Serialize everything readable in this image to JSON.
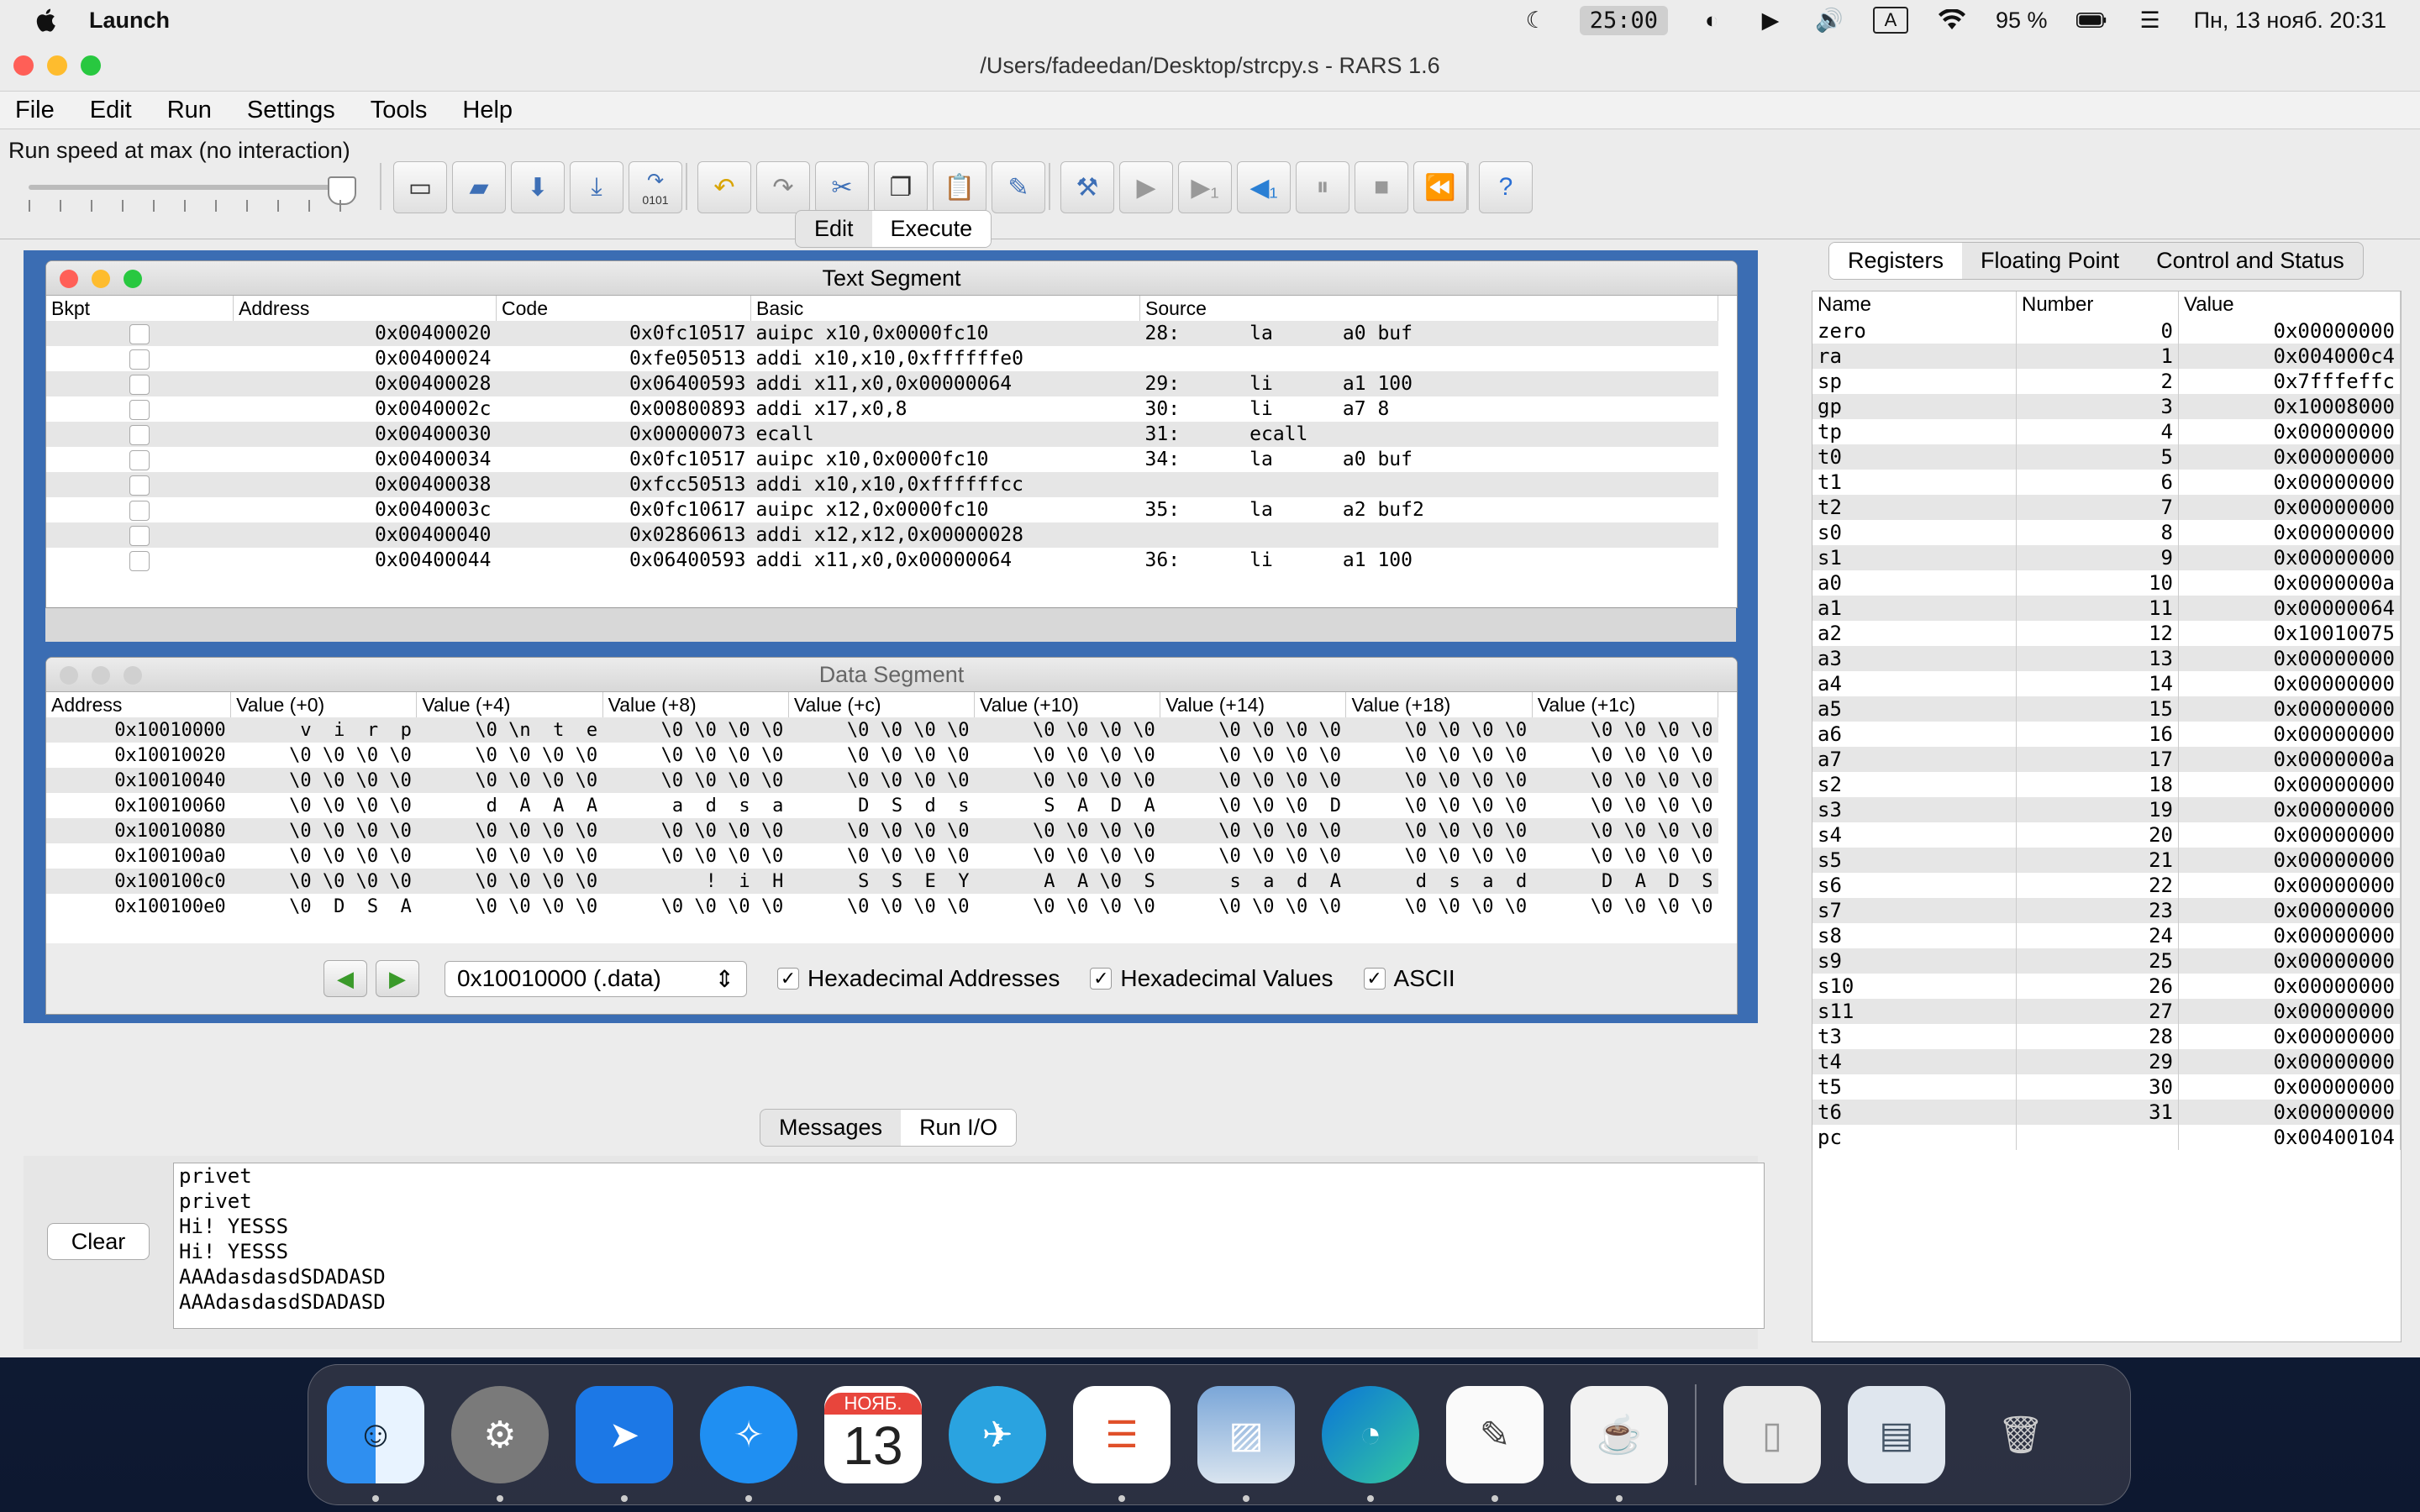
{
  "menubar": {
    "app_name": "Launch",
    "timer": "25:00",
    "keyboard_layout": "A",
    "battery": "95 %",
    "datetime": "Пн, 13 нояб.  20:31"
  },
  "window": {
    "title": "/Users/fadeedan/Desktop/strcpy.s  - RARS 1.6",
    "menu": [
      "File",
      "Edit",
      "Run",
      "Settings",
      "Tools",
      "Help"
    ]
  },
  "toolbar": {
    "run_speed": "Run speed at max (no interaction)",
    "open_label": "0101"
  },
  "tabs": {
    "edit": "Edit",
    "execute": "Execute"
  },
  "text_segment": {
    "title": "Text Segment",
    "headers": [
      "Bkpt",
      "Address",
      "Code",
      "Basic",
      "Source"
    ],
    "rows": [
      [
        "",
        "0x00400020",
        "0x0fc10517",
        "auipc x10,0x0000fc10",
        "28:      la      a0 buf"
      ],
      [
        "",
        "0x00400024",
        "0xfe050513",
        "addi x10,x10,0xffffffe0",
        ""
      ],
      [
        "",
        "0x00400028",
        "0x06400593",
        "addi x11,x0,0x00000064",
        "29:      li      a1 100"
      ],
      [
        "",
        "0x0040002c",
        "0x00800893",
        "addi x17,x0,8",
        "30:      li      a7 8"
      ],
      [
        "",
        "0x00400030",
        "0x00000073",
        "ecall",
        "31:      ecall"
      ],
      [
        "",
        "0x00400034",
        "0x0fc10517",
        "auipc x10,0x0000fc10",
        "34:      la      a0 buf"
      ],
      [
        "",
        "0x00400038",
        "0xfcc50513",
        "addi x10,x10,0xffffffcc",
        ""
      ],
      [
        "",
        "0x0040003c",
        "0x0fc10617",
        "auipc x12,0x0000fc10",
        "35:      la      a2 buf2"
      ],
      [
        "",
        "0x00400040",
        "0x02860613",
        "addi x12,x12,0x00000028",
        ""
      ],
      [
        "",
        "0x00400044",
        "0x06400593",
        "addi x11,x0,0x00000064",
        "36:      li      a1 100"
      ]
    ]
  },
  "data_segment": {
    "title": "Data Segment",
    "headers": [
      "Address",
      "Value (+0)",
      "Value (+4)",
      "Value (+8)",
      "Value (+c)",
      "Value (+10)",
      "Value (+14)",
      "Value (+18)",
      "Value (+1c)"
    ],
    "rows": [
      [
        "0x10010000",
        "v  i  r  p",
        "\\0 \\n  t  e",
        "\\0 \\0 \\0 \\0",
        "\\0 \\0 \\0 \\0",
        "\\0 \\0 \\0 \\0",
        "\\0 \\0 \\0 \\0",
        "\\0 \\0 \\0 \\0",
        "\\0 \\0 \\0 \\0"
      ],
      [
        "0x10010020",
        "\\0 \\0 \\0 \\0",
        "\\0 \\0 \\0 \\0",
        "\\0 \\0 \\0 \\0",
        "\\0 \\0 \\0 \\0",
        "\\0 \\0 \\0 \\0",
        "\\0 \\0 \\0 \\0",
        "\\0 \\0 \\0 \\0",
        "\\0 \\0 \\0 \\0"
      ],
      [
        "0x10010040",
        "\\0 \\0 \\0 \\0",
        "\\0 \\0 \\0 \\0",
        "\\0 \\0 \\0 \\0",
        "\\0 \\0 \\0 \\0",
        "\\0 \\0 \\0 \\0",
        "\\0 \\0 \\0 \\0",
        "\\0 \\0 \\0 \\0",
        "\\0 \\0 \\0 \\0"
      ],
      [
        "0x10010060",
        "\\0 \\0 \\0 \\0",
        "d  A  A  A",
        "a  d  s  a",
        "D  S  d  s",
        "S  A  D  A",
        "\\0 \\0 \\0  D",
        "\\0 \\0 \\0 \\0",
        "\\0 \\0 \\0 \\0"
      ],
      [
        "0x10010080",
        "\\0 \\0 \\0 \\0",
        "\\0 \\0 \\0 \\0",
        "\\0 \\0 \\0 \\0",
        "\\0 \\0 \\0 \\0",
        "\\0 \\0 \\0 \\0",
        "\\0 \\0 \\0 \\0",
        "\\0 \\0 \\0 \\0",
        "\\0 \\0 \\0 \\0"
      ],
      [
        "0x100100a0",
        "\\0 \\0 \\0 \\0",
        "\\0 \\0 \\0 \\0",
        "\\0 \\0 \\0 \\0",
        "\\0 \\0 \\0 \\0",
        "\\0 \\0 \\0 \\0",
        "\\0 \\0 \\0 \\0",
        "\\0 \\0 \\0 \\0",
        "\\0 \\0 \\0 \\0"
      ],
      [
        "0x100100c0",
        "\\0 \\0 \\0 \\0",
        "\\0 \\0 \\0 \\0",
        "!  i  H",
        "S  S  E  Y",
        "A  A \\0  S",
        "s  a  d  A",
        "d  s  a  d",
        "D  A  D  S"
      ],
      [
        "0x100100e0",
        "\\0  D  S  A",
        "\\0 \\0 \\0 \\0",
        "\\0 \\0 \\0 \\0",
        "\\0 \\0 \\0 \\0",
        "\\0 \\0 \\0 \\0",
        "\\0 \\0 \\0 \\0",
        "\\0 \\0 \\0 \\0",
        "\\0 \\0 \\0 \\0"
      ]
    ],
    "address_select": "0x10010000 (.data)",
    "options": [
      "Hexadecimal Addresses",
      "Hexadecimal Values",
      "ASCII"
    ]
  },
  "io": {
    "tabs": [
      "Messages",
      "Run I/O"
    ],
    "clear_label": "Clear",
    "lines": [
      "privet",
      "privet",
      "Hi! YESSS",
      "Hi! YESSS",
      "AAAdasdasdSDADASD",
      "AAAdasdasdSDADASD"
    ]
  },
  "registers": {
    "tabs": [
      "Registers",
      "Floating Point",
      "Control and Status"
    ],
    "headers": [
      "Name",
      "Number",
      "Value"
    ],
    "rows": [
      [
        "zero",
        "0",
        "0x00000000"
      ],
      [
        "ra",
        "1",
        "0x004000c4"
      ],
      [
        "sp",
        "2",
        "0x7fffeffc"
      ],
      [
        "gp",
        "3",
        "0x10008000"
      ],
      [
        "tp",
        "4",
        "0x00000000"
      ],
      [
        "t0",
        "5",
        "0x00000000"
      ],
      [
        "t1",
        "6",
        "0x00000000"
      ],
      [
        "t2",
        "7",
        "0x00000000"
      ],
      [
        "s0",
        "8",
        "0x00000000"
      ],
      [
        "s1",
        "9",
        "0x00000000"
      ],
      [
        "a0",
        "10",
        "0x0000000a"
      ],
      [
        "a1",
        "11",
        "0x00000064"
      ],
      [
        "a2",
        "12",
        "0x10010075"
      ],
      [
        "a3",
        "13",
        "0x00000000"
      ],
      [
        "a4",
        "14",
        "0x00000000"
      ],
      [
        "a5",
        "15",
        "0x00000000"
      ],
      [
        "a6",
        "16",
        "0x00000000"
      ],
      [
        "a7",
        "17",
        "0x0000000a"
      ],
      [
        "s2",
        "18",
        "0x00000000"
      ],
      [
        "s3",
        "19",
        "0x00000000"
      ],
      [
        "s4",
        "20",
        "0x00000000"
      ],
      [
        "s5",
        "21",
        "0x00000000"
      ],
      [
        "s6",
        "22",
        "0x00000000"
      ],
      [
        "s7",
        "23",
        "0x00000000"
      ],
      [
        "s8",
        "24",
        "0x00000000"
      ],
      [
        "s9",
        "25",
        "0x00000000"
      ],
      [
        "s10",
        "26",
        "0x00000000"
      ],
      [
        "s11",
        "27",
        "0x00000000"
      ],
      [
        "t3",
        "28",
        "0x00000000"
      ],
      [
        "t4",
        "29",
        "0x00000000"
      ],
      [
        "t5",
        "30",
        "0x00000000"
      ],
      [
        "t6",
        "31",
        "0x00000000"
      ],
      [
        "pc",
        "",
        "0x00400104"
      ]
    ]
  },
  "dock": {
    "calendar_month": "НОЯБ.",
    "calendar_day": "13"
  }
}
